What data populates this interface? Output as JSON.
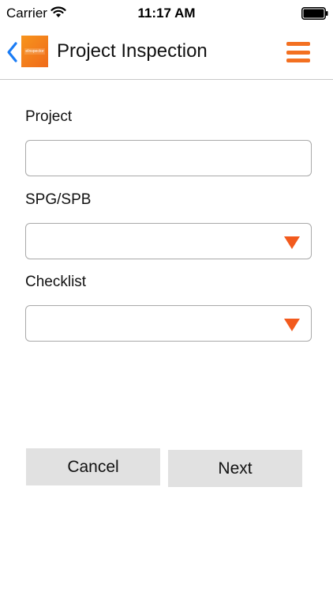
{
  "status_bar": {
    "carrier": "Carrier",
    "time": "11:17 AM",
    "wifi_icon": "wifi-icon",
    "battery_icon": "battery-icon"
  },
  "nav": {
    "back_icon": "chevron-left-icon",
    "logo_text": "eInspector",
    "title": "Project Inspection",
    "menu_icon": "hamburger-menu-icon",
    "accent_color": "#F37021",
    "back_color": "#1A7CF5"
  },
  "form": {
    "project": {
      "label": "Project",
      "value": "",
      "placeholder": ""
    },
    "spg_spb": {
      "label": "SPG/SPB",
      "selected": ""
    },
    "checklist": {
      "label": "Checklist",
      "selected": ""
    },
    "dropdown_icon": "triangle-down-icon"
  },
  "buttons": {
    "cancel_label": "Cancel",
    "next_label": "Next"
  }
}
